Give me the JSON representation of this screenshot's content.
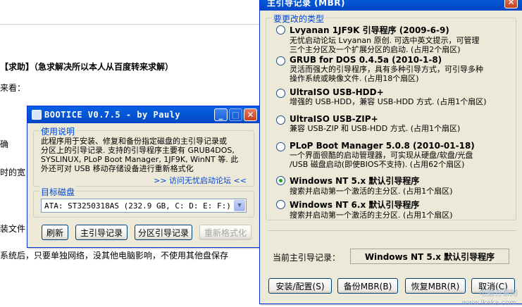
{
  "background": {
    "heading": "【求助】（急求解决所以本人从百度转来求解）",
    "line1": "来看：",
    "line2": "确",
    "line3": "时的宽",
    "line4": "装文件",
    "line5": "系统后，只要单独网络，没其他电脑影响，不使用其他盘保存"
  },
  "bootice": {
    "title": "BOOTICE V0.7.5 - by Pauly",
    "usage_label": "使用说明",
    "usage_text": [
      "此程序用于安装、修复和备份指定磁盘的主引导记录或",
      "分区上的引导记录. 支持的引导程序主要有 GRUB4DOS,",
      "SYSLINUX, PLoP Boot Manager, 1JF9K, WinNT 等. 此",
      "外还可对 USB 移动存储设备进行重新格式化"
    ],
    "forum_link": ">> 访问无忧启动论坛 <<",
    "target_label": "目标磁盘",
    "disk_value": "ATA: ST3250318AS (232.9 GB, C: D: E: F:)",
    "buttons": {
      "refresh": "刷新",
      "mbr": "主引导记录",
      "pbr": "分区引导记录",
      "format": "重新格式化"
    }
  },
  "mbr": {
    "title": "主引导记录 (MBR)",
    "type_label": "要更改的类型",
    "options": [
      {
        "title": "Lvyanan 1JF9K 引导程序 (2009-6-9)",
        "desc": [
          "无忧启动论坛 Lvyanan 原创. 可选中英文提示，可管理",
          "三个主分区及一个扩展分区的启动. (占用2个扇区)"
        ],
        "checked": false
      },
      {
        "title": "GRUB for DOS 0.4.5a (2010-1-8)",
        "desc": [
          "灵活而强大的引导程序，具有多种引导方式，可引导多种",
          "操作系统或映像文件. (占用18个扇区)"
        ],
        "checked": false
      },
      {
        "title": "UltraISO USB-HDD+",
        "desc": [
          "增强的 USB-HDD，兼容 USB-HDD 方式. (占用1个扇区)"
        ],
        "checked": false
      },
      {
        "title": "UltraISO USB-ZIP+",
        "desc": [
          "兼容 USB-ZIP 和 USB-HDD 方式. (占用1个扇区)"
        ],
        "checked": false
      },
      {
        "title": "PLoP Boot Manager 5.0.8 (2010-01-18)",
        "desc": [
          "一个界面很酷的启动管理器，可实现从硬盘/软盘/光盘",
          "/USB 磁盘启动(即使BIOS不支持). (占用62个扇区)"
        ],
        "checked": false
      },
      {
        "title": "Windows NT 5.x 默认引导程序",
        "desc": [
          "搜索并启动第一个激活的主分区. (占用1个扇区)"
        ],
        "checked": true
      },
      {
        "title": "Windows NT 6.x 默认引导程序",
        "desc": [
          "搜索并启动第一个激活的主分区. (占用1个扇区)"
        ],
        "checked": false
      }
    ],
    "current_label": "当前主引导记录：",
    "current_value": "Windows NT 5.x 默认引导程序",
    "buttons": {
      "install": "安装/配置(S)",
      "backup": "备份MBR(B)",
      "restore": "恢复MBR(R)",
      "cancel": "取消(C)"
    }
  },
  "watermark": {
    "text": "电脑百事网",
    "url": "www.ikaka.com"
  }
}
